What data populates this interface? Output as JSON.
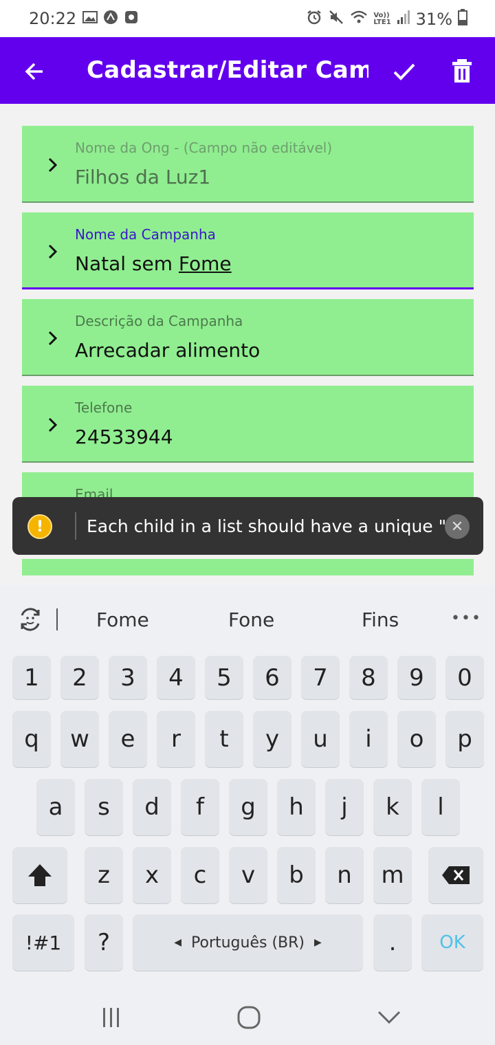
{
  "status_bar": {
    "time": "20:22",
    "battery": "31%",
    "left_icons": [
      "image-icon",
      "app-icon",
      "record-icon"
    ],
    "right_icons": [
      "alarm-icon",
      "mute-icon",
      "wifi-icon",
      "volte-icon",
      "signal-icon",
      "battery-icon"
    ]
  },
  "app_bar": {
    "title": "Cadastrar/Editar Cam..",
    "back_icon": "arrow-back-icon",
    "confirm_icon": "check-icon",
    "delete_icon": "trash-icon",
    "color": "#6200ee"
  },
  "form": {
    "fields": [
      {
        "label": "Nome da Ong - (Campo não editável)",
        "value": "Filhos da Luz1"
      },
      {
        "label": "Nome da Campanha",
        "value_prefix": "Natal sem ",
        "value_underlined": "Fome"
      },
      {
        "label": "Descrição da Campanha",
        "value": "Arrecadar alimento"
      },
      {
        "label": "Telefone",
        "value": "24533944"
      },
      {
        "label": "Email",
        "value": ""
      }
    ],
    "field_color": "#90ee90"
  },
  "toast": {
    "message": "Each child in a list should have a unique \"k...",
    "icon": "warning-icon",
    "close_icon": "close-icon"
  },
  "keyboard": {
    "suggestions": [
      "Fome",
      "Fone",
      "Fins"
    ],
    "row_numbers": [
      "1",
      "2",
      "3",
      "4",
      "5",
      "6",
      "7",
      "8",
      "9",
      "0"
    ],
    "row_1": [
      "q",
      "w",
      "e",
      "r",
      "t",
      "y",
      "u",
      "i",
      "o",
      "p"
    ],
    "row_2": [
      "a",
      "s",
      "d",
      "f",
      "g",
      "h",
      "j",
      "k",
      "l"
    ],
    "row_3": [
      "z",
      "x",
      "c",
      "v",
      "b",
      "n",
      "m"
    ],
    "symbols_label": "!#1",
    "question_label": "?",
    "language_label": "Português (BR)",
    "period_label": ".",
    "ok_label": "OK"
  },
  "nav_bar": {
    "icons": [
      "recent-apps-icon",
      "home-icon",
      "back-icon"
    ]
  }
}
